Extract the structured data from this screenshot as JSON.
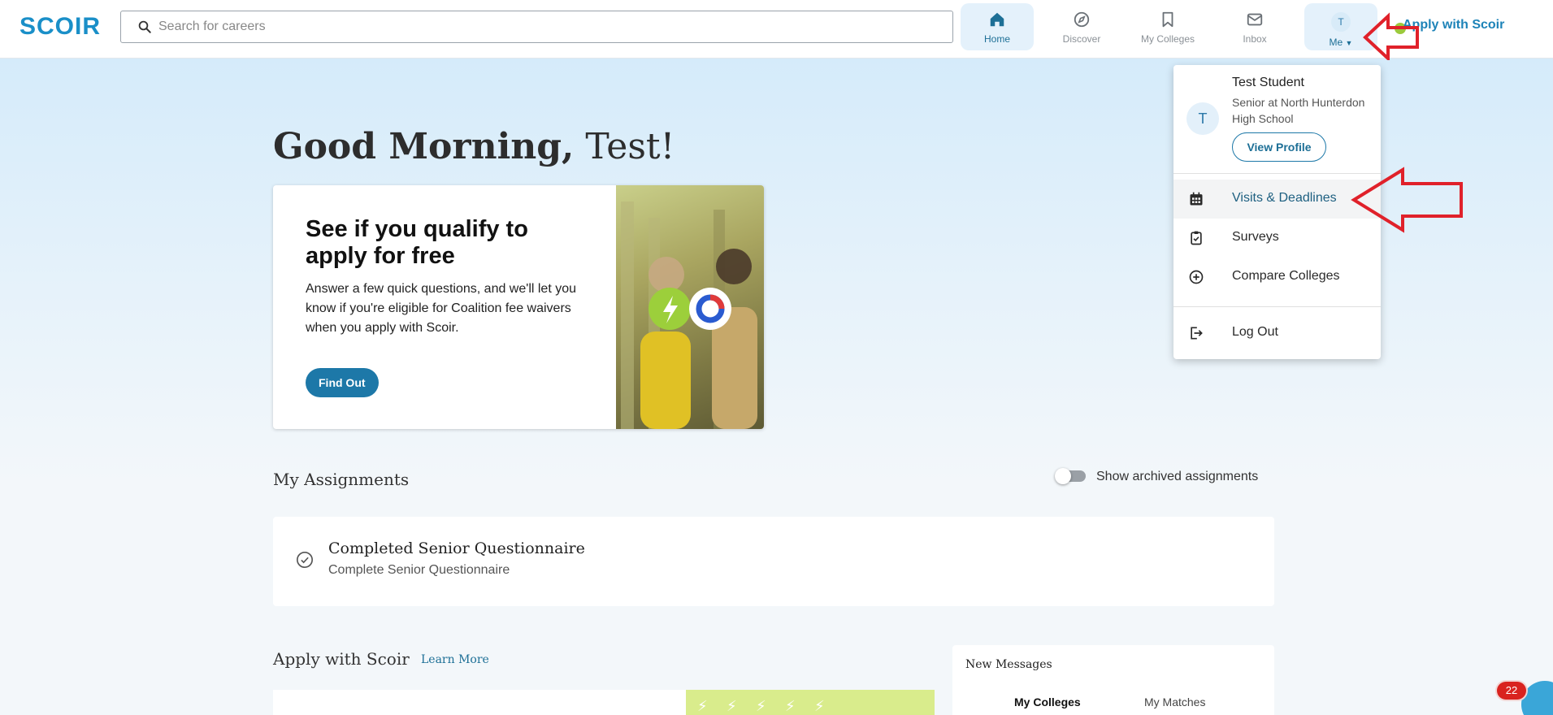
{
  "header": {
    "logo": "SCOIR",
    "search_placeholder": "Search for careers",
    "nav": [
      {
        "label": "Home",
        "icon": "home-icon"
      },
      {
        "label": "Discover",
        "icon": "compass-icon"
      },
      {
        "label": "My Colleges",
        "icon": "bookmark-icon"
      },
      {
        "label": "Inbox",
        "icon": "inbox-icon"
      }
    ],
    "me": {
      "avatar": "T",
      "label": "Me"
    },
    "apply_link": "Apply with Scoir"
  },
  "main": {
    "greeting_bold": "Good Morning,",
    "greeting_name": "Test!",
    "promo": {
      "title": "See if you qualify to apply for free",
      "text": "Answer a few quick questions, and we'll let you know if you're eligible for Coalition fee waivers when you apply with Scoir.",
      "button": "Find Out"
    },
    "assignments": {
      "title": "My Assignments",
      "toggle_label": "Show archived assignments",
      "items": [
        {
          "name": "Completed Senior Questionnaire",
          "sub": "Complete Senior Questionnaire"
        }
      ]
    },
    "apply": {
      "title": "Apply with Scoir",
      "learn_more": "Learn More"
    },
    "messages": {
      "title": "New Messages",
      "tabs": [
        "My Colleges",
        "My Matches"
      ]
    },
    "chat_badge": "22"
  },
  "dropdown": {
    "avatar": "T",
    "name": "Test Student",
    "school": "Senior at North Hunterdon High School",
    "view_profile": "View Profile",
    "items": [
      {
        "label": "Visits & Deadlines",
        "icon": "calendar-icon"
      },
      {
        "label": "Surveys",
        "icon": "clipboard-check-icon"
      },
      {
        "label": "Compare Colleges",
        "icon": "plus-circle-icon"
      },
      {
        "label": "Log Out",
        "icon": "logout-icon"
      }
    ]
  },
  "colors": {
    "accent": "#1d78a8",
    "annotation": "#e0212a",
    "hero_top": "#d5ebfa"
  }
}
